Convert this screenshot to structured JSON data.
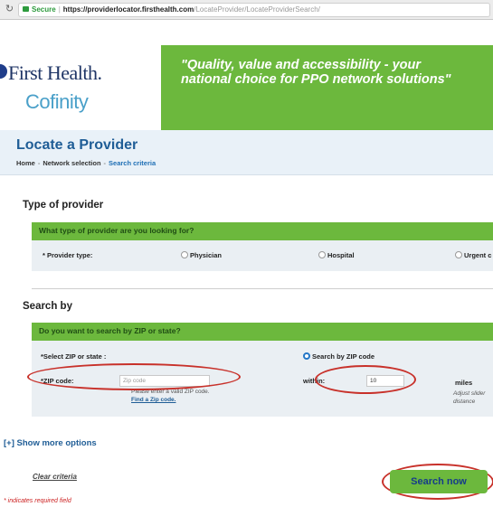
{
  "browser": {
    "secure_label": "Secure",
    "url_host": "https://providerlocator.firsthealth.com",
    "url_path": "/LocateProvider/LocateProviderSearch/"
  },
  "header": {
    "logo_primary": "First Health.",
    "logo_secondary": "Cofinity",
    "tagline": "\"Quality, value and accessibility - your national choice for PPO network solutions\""
  },
  "page": {
    "title": "Locate a Provider",
    "breadcrumb": [
      "Home",
      "Network selection",
      "Search criteria"
    ]
  },
  "provider_section": {
    "heading": "Type of provider",
    "question": "What type of provider are you looking for?",
    "field_label": "* Provider type:",
    "options": [
      "Physician",
      "Hospital",
      "Urgent c"
    ]
  },
  "search_section": {
    "heading": "Search by",
    "question": "Do you want to search by ZIP or state?",
    "select_label": "*Select ZIP or state :",
    "zip_option": "Search by ZIP code",
    "zip_label": "*ZIP code:",
    "zip_placeholder": "Zip code",
    "zip_hint": "Please enter a valid ZIP code.",
    "zip_link": "Find a Zip code.",
    "within_label": "within:",
    "within_value": "10",
    "miles_label": "miles",
    "adjust_hint_1": "Adjust slider",
    "adjust_hint_2": "distance"
  },
  "actions": {
    "more_options": "[+] Show more options",
    "clear": "Clear criteria",
    "search": "Search now",
    "required_note": "* indicates required field"
  },
  "colors": {
    "brand_green": "#6cb83d",
    "brand_blue": "#1f5d96",
    "annotation_red": "#c8312a"
  }
}
